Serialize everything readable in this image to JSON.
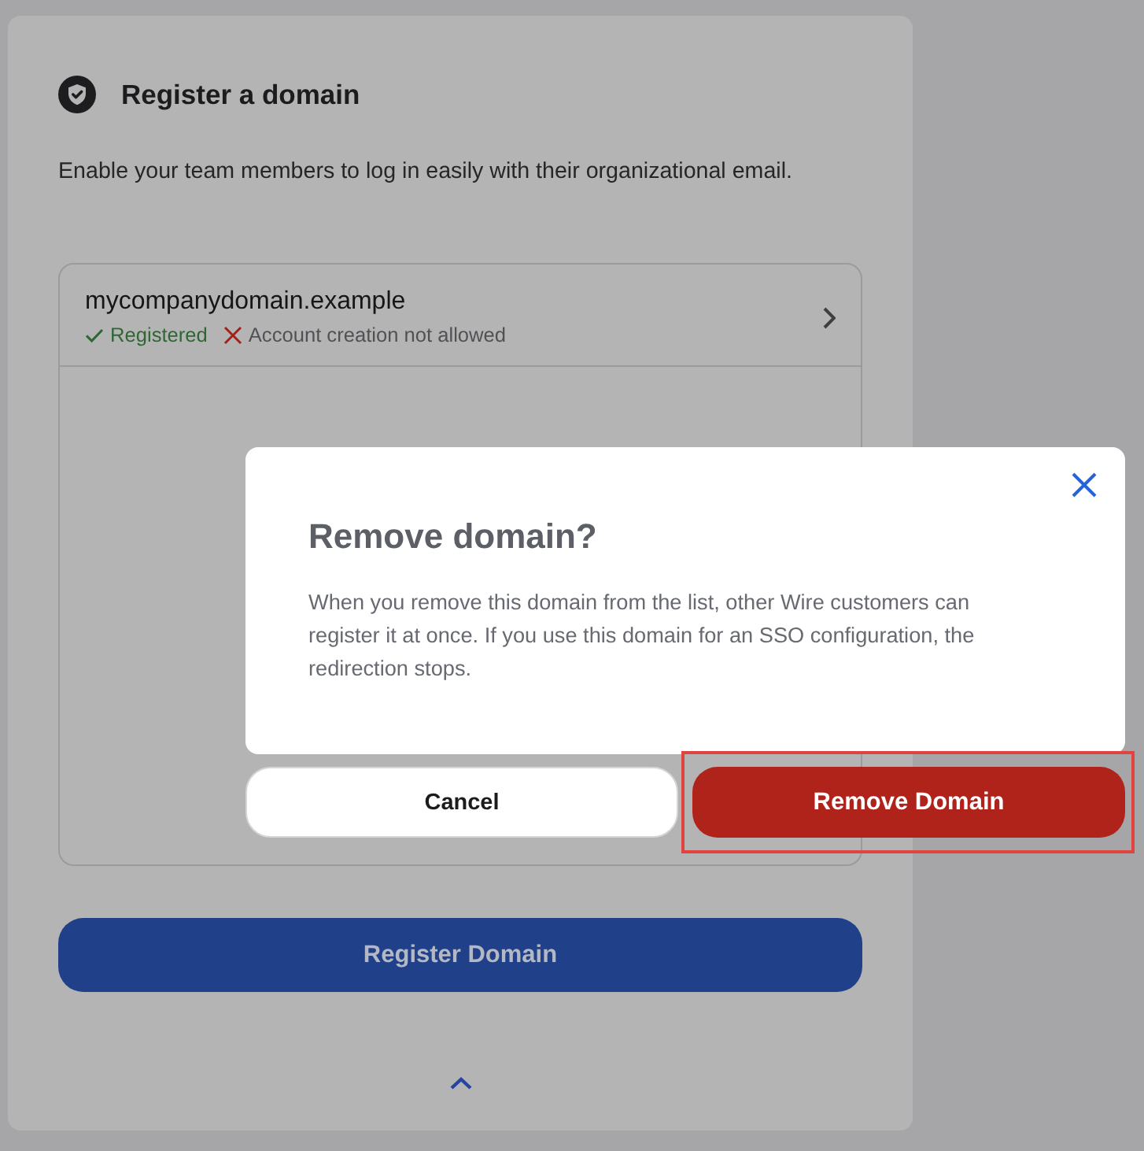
{
  "card": {
    "title": "Register a domain",
    "description": "Enable your team members to log in easily with their organizational email.",
    "domains": [
      {
        "name": "mycompanydomain.example",
        "statuses": [
          {
            "kind": "ok",
            "label": "Registered"
          },
          {
            "kind": "error",
            "label": "Account creation not allowed"
          }
        ]
      }
    ],
    "primary_button": "Register Domain"
  },
  "dialog": {
    "title": "Remove domain?",
    "body": "When you remove this domain from the list, other Wire customers can register it at once. If you use this domain for an SSO configuration, the redirection stops.",
    "buttons": [
      {
        "label": "Cancel",
        "kind": "secondary",
        "highlighted": false
      },
      {
        "label": "Remove Domain",
        "kind": "danger",
        "highlighted": true
      }
    ]
  }
}
